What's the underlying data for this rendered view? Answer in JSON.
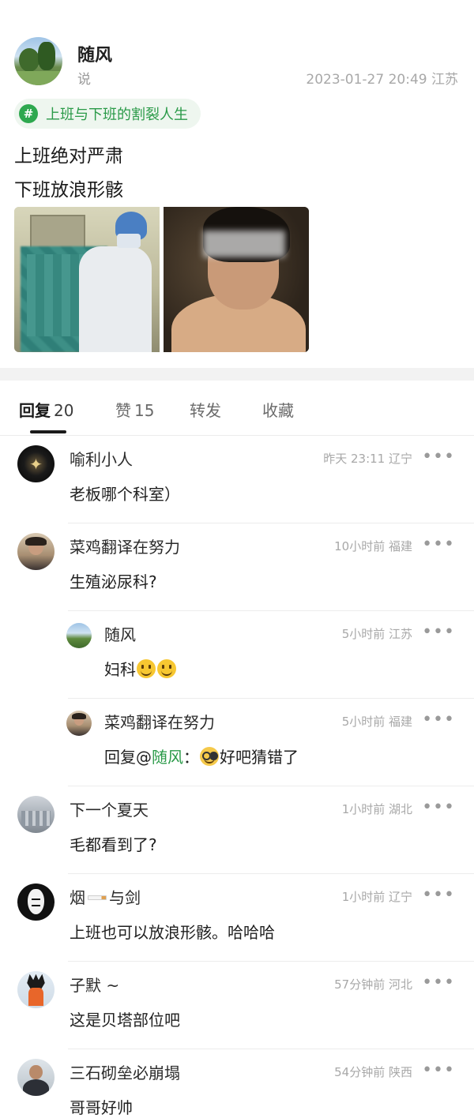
{
  "post": {
    "author": "随风",
    "subtitle": "说",
    "meta": "2023-01-27 20:49 江苏",
    "topic_icon": "#",
    "topic": "上班与下班的割裂人生",
    "lines": [
      "上班绝对严肃",
      "下班放浪形骸"
    ]
  },
  "tabs": [
    {
      "label": "回复",
      "count": "20",
      "active": true
    },
    {
      "label": "赞",
      "count": "15"
    },
    {
      "label": "转发",
      "count": ""
    },
    {
      "label": "收藏",
      "count": ""
    }
  ],
  "comments": [
    {
      "name": "喻利小人",
      "meta": "昨天 23:11 辽宁",
      "text": "老板哪个科室）",
      "avatar": "dark-sparkle-avatar"
    },
    {
      "name": "菜鸡翻译在努力",
      "meta": "10小时前 福建",
      "text": "生殖泌尿科?",
      "avatar": "person-avatar"
    },
    {
      "name": "随风",
      "meta": "5小时前 江苏",
      "text": "妇科",
      "avatar": "landscape-avatar",
      "reply": true
    },
    {
      "name": "菜鸡翻译在努力",
      "meta": "5小时前 福建",
      "text_prefix": "回复@",
      "mention": "随风",
      "text_colon": "：",
      "text": "好吧猜错了",
      "avatar": "person-avatar",
      "reply": true
    },
    {
      "name": "下一个夏天",
      "meta": "1小时前 湖北",
      "text": "毛都看到了?",
      "avatar": "building-avatar"
    },
    {
      "name": "烟",
      "name_suffix": "与剑",
      "meta": "1小时前 辽宁",
      "text": "上班也可以放浪形骸。哈哈哈",
      "avatar": "mask-avatar"
    },
    {
      "name": "子默 ~",
      "meta": "57分钟前 河北",
      "text": "这是贝塔部位吧",
      "avatar": "anime-avatar"
    },
    {
      "name": "三石砌垒必崩塌",
      "meta": "54分钟前 陕西",
      "text": "哥哥好帅",
      "avatar": "man-avatar"
    }
  ],
  "more_glyph": "•••",
  "colors": {
    "accent_green": "#2a9a48",
    "tag_bg": "#eef6ef",
    "meta_gray": "#a8a8a8"
  }
}
